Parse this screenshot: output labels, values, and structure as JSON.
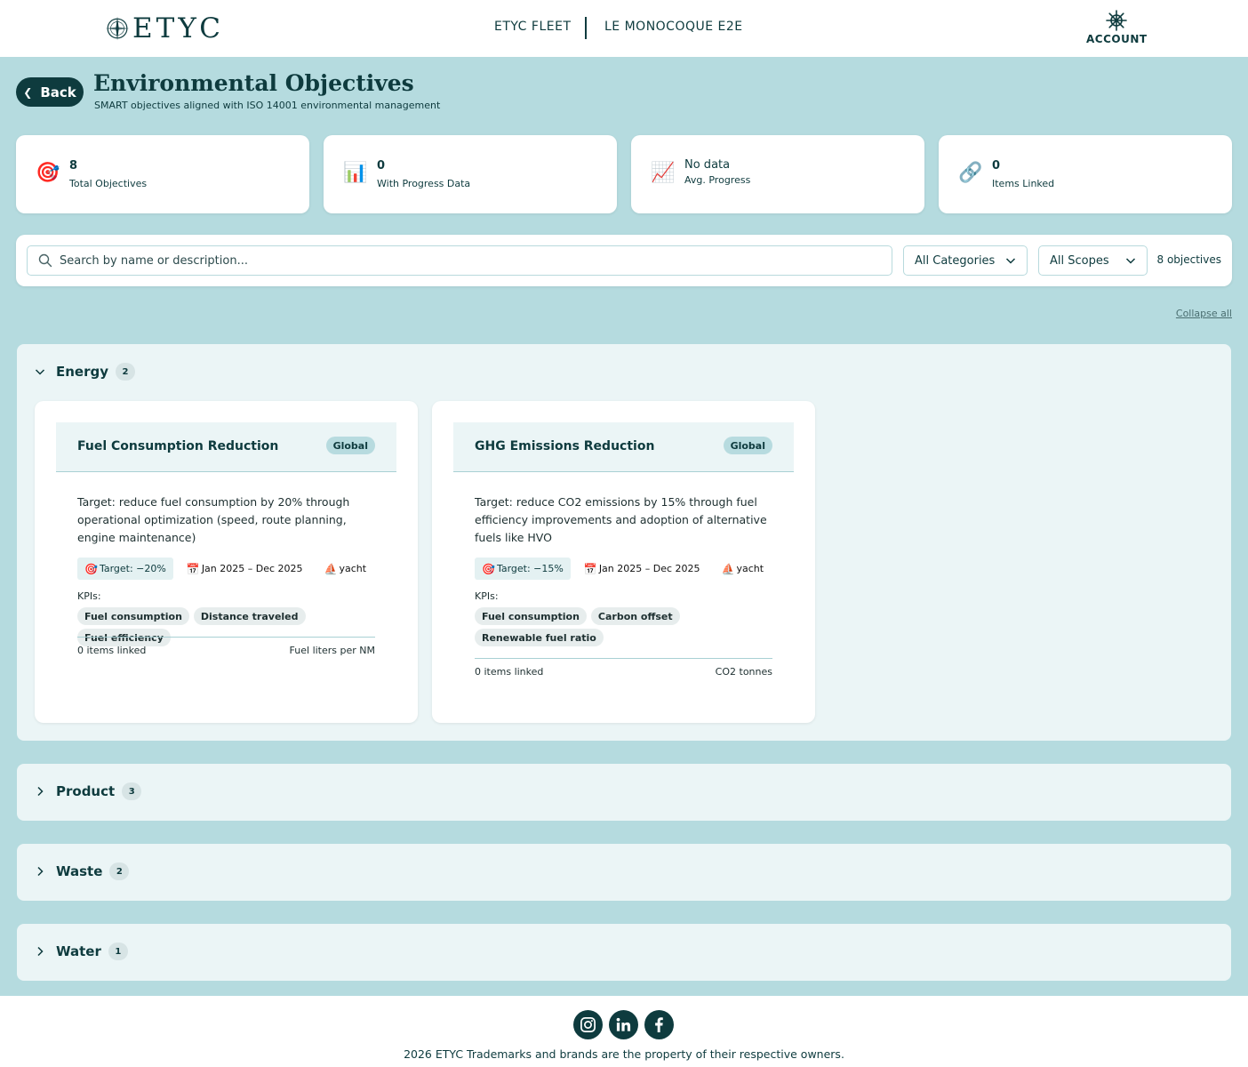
{
  "header": {
    "logo_text": "ETYC",
    "fleet_label": "ETYC FLEET",
    "vessel_label": "LE MONOCOQUE E2E",
    "account_label": "ACCOUNT"
  },
  "page": {
    "back_label": "Back",
    "title": "Environmental Objectives",
    "subtitle": "SMART objectives aligned with ISO 14001 environmental management"
  },
  "stats": [
    {
      "icon": "target-icon",
      "value": "8",
      "label": "Total Objectives"
    },
    {
      "icon": "bar-chart-icon",
      "value": "0",
      "label": "With Progress Data"
    },
    {
      "icon": "trend-chart-icon",
      "value": "No data",
      "label": "Avg. Progress"
    },
    {
      "icon": "link-icon",
      "value": "0",
      "label": "Items Linked"
    }
  ],
  "filters": {
    "search_placeholder": "Search by name or description...",
    "category_selected": "All Categories",
    "scope_selected": "All Scopes",
    "count_label": "8 objectives",
    "collapse_all": "Collapse all"
  },
  "categories": [
    {
      "name": "Energy",
      "count": "2",
      "expanded": true
    },
    {
      "name": "Product",
      "count": "3",
      "expanded": false
    },
    {
      "name": "Waste",
      "count": "2",
      "expanded": false
    },
    {
      "name": "Water",
      "count": "1",
      "expanded": false
    }
  ],
  "objectives": [
    {
      "title": "Fuel Consumption Reduction",
      "scope": "Global",
      "description": "Target: reduce fuel consumption by 20% through operational optimization (speed, route planning, engine maintenance)",
      "target": "Target: −20%",
      "period": "Jan 2025 – Dec 2025",
      "vessel_type": "yacht",
      "kpi_label": "KPIs:",
      "kpis": [
        "Fuel consumption",
        "Distance traveled",
        "Fuel efficiency"
      ],
      "linked": "0 items linked",
      "unit": "Fuel liters per NM"
    },
    {
      "title": "GHG Emissions Reduction",
      "scope": "Global",
      "description": "Target: reduce CO2 emissions by 15% through fuel efficiency improvements and adoption of alternative fuels like HVO",
      "target": "Target: −15%",
      "period": "Jan 2025 – Dec 2025",
      "vessel_type": "yacht",
      "kpi_label": "KPIs:",
      "kpis": [
        "Fuel consumption",
        "Carbon offset",
        "Renewable fuel ratio"
      ],
      "linked": "0 items linked",
      "unit": "CO2 tonnes"
    }
  ],
  "footer": {
    "copyright": "2026 ETYC Trademarks and brands are the property of their respective owners."
  }
}
